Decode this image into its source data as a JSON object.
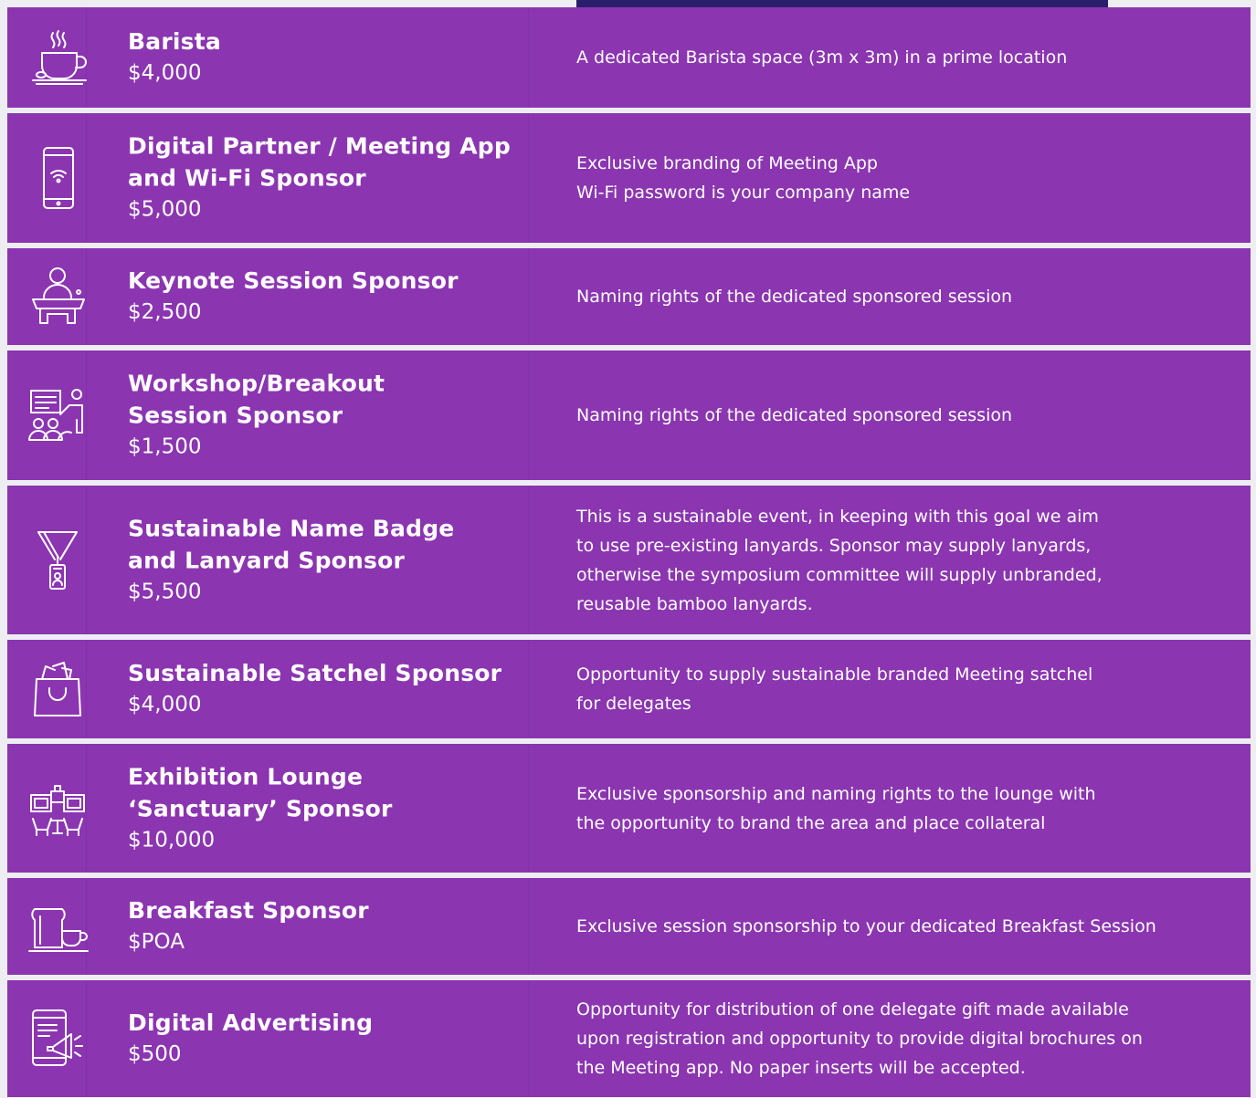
{
  "sponsorships": [
    {
      "icon": "coffee-cup-icon",
      "title_lines": [
        "Barista"
      ],
      "price": "$4,000",
      "description_lines": [
        "A dedicated Barista space (3m x 3m) in a prime location"
      ]
    },
    {
      "icon": "smartphone-wifi-icon",
      "title_lines": [
        "Digital Partner / Meeting App",
        "and Wi-Fi Sponsor"
      ],
      "price": "$5,000",
      "description_lines": [
        "Exclusive branding of Meeting App",
        "Wi-Fi password is your company name"
      ]
    },
    {
      "icon": "speaker-podium-icon",
      "title_lines": [
        "Keynote Session Sponsor"
      ],
      "price": "$2,500",
      "description_lines": [
        "Naming rights of the dedicated sponsored session"
      ]
    },
    {
      "icon": "presentation-audience-icon",
      "title_lines": [
        "Workshop/Breakout",
        "Session Sponsor"
      ],
      "price": "$1,500",
      "description_lines": [
        "Naming rights of the dedicated sponsored session"
      ]
    },
    {
      "icon": "lanyard-badge-icon",
      "title_lines": [
        "Sustainable Name Badge",
        "and Lanyard Sponsor"
      ],
      "price": "$5,500",
      "description_lines": [
        "This is a sustainable event, in keeping with this goal we aim",
        "to use pre-existing lanyards. Sponsor may supply lanyards,",
        "otherwise the symposium committee will supply unbranded,",
        "reusable bamboo lanyards."
      ]
    },
    {
      "icon": "shopping-bag-icon",
      "title_lines": [
        "Sustainable Satchel Sponsor"
      ],
      "price": "$4,000",
      "description_lines": [
        "Opportunity to supply sustainable branded Meeting satchel",
        "for delegates"
      ]
    },
    {
      "icon": "lounge-icon",
      "title_lines": [
        "Exhibition Lounge",
        "‘Sanctuary’ Sponsor"
      ],
      "price": "$10,000",
      "description_lines": [
        "Exclusive sponsorship and naming rights to the lounge with",
        "the opportunity to brand the area and place collateral"
      ]
    },
    {
      "icon": "toast-coffee-icon",
      "title_lines": [
        "Breakfast Sponsor"
      ],
      "price": "$POA",
      "description_lines": [
        "Exclusive session sponsorship to your dedicated Breakfast Session"
      ]
    },
    {
      "icon": "tablet-megaphone-icon",
      "title_lines": [
        "Digital Advertising"
      ],
      "price": "$500",
      "description_lines": [
        "Opportunity for distribution of one delegate gift made available",
        "upon registration and opportunity to provide digital brochures on",
        "the Meeting app. No paper inserts will be accepted."
      ]
    }
  ],
  "colors": {
    "row_background": "#8b35b1",
    "page_background": "#eeeef2",
    "top_bar": "#2a1d6b",
    "text": "#ffffff"
  }
}
